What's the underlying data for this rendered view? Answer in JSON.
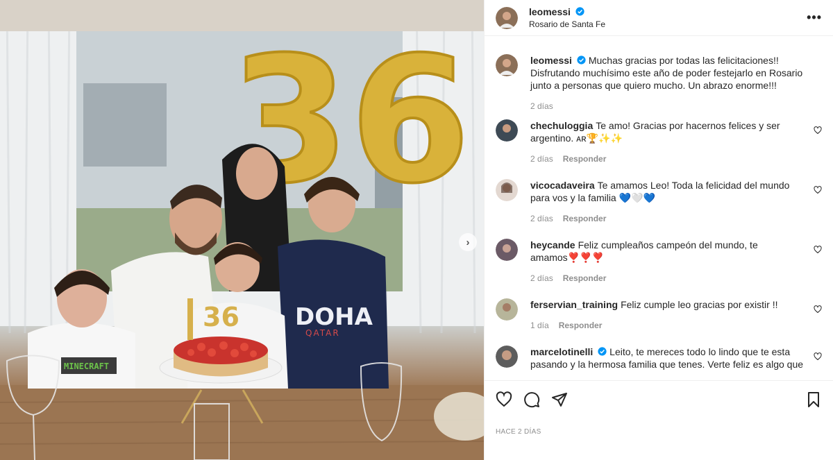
{
  "post": {
    "username": "leomessi",
    "location": "Rosario de Santa Fe",
    "more_label": "•••",
    "caption": "Muchas gracias por todas las felicitaciones!! Disfrutando muchísimo este año de poder festejarlo en Rosario junto a personas que quiero mucho. Un abrazo enorme!!!",
    "caption_time": "2 días",
    "date": "HACE 2 DÍAS"
  },
  "comments": [
    {
      "username": "chechuloggia",
      "text": "Te amo! Gracias por hacernos felices y ser argentino. ᴀʀ🏆✨✨",
      "time": "2 días",
      "reply": "Responder"
    },
    {
      "username": "vicocadaveira",
      "text": "Te amamos Leo! Toda la felicidad del mundo para vos y la familia 💙🤍💙",
      "time": "2 días",
      "reply": "Responder"
    },
    {
      "username": "heycande",
      "text": "Feliz cumpleaños campeón del mundo, te amamos❣️❣️❣️",
      "time": "2 días",
      "reply": "Responder"
    },
    {
      "username": "ferservian_training",
      "text": "Feliz cumple leo gracias por existir !!",
      "time": "1 día",
      "reply": "Responder"
    },
    {
      "username": "marcelotinelli",
      "text": "Leito, te mereces todo lo lindo que te esta pasando y la hermosa familia que tenes. Verte feliz es algo que",
      "time": "",
      "reply": ""
    }
  ],
  "photo": {
    "balloon_text": "36",
    "cake_topper": "36",
    "shirt_text": "DOHA",
    "shirt_sub": "QATAR",
    "minecraft_text": "MINECRAFT"
  },
  "icons": [
    "verified-badge-icon",
    "more-options-icon",
    "heart-icon",
    "comment-icon",
    "share-icon",
    "bookmark-icon",
    "next-arrow-icon"
  ],
  "colors": {
    "verified": "#0095f6",
    "muted": "#8e8e8e",
    "text": "#262626"
  }
}
